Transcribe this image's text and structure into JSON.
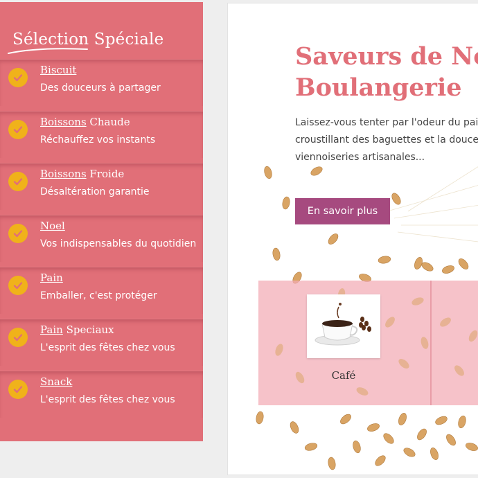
{
  "sidebar": {
    "title": "Sélection Spéciale",
    "items": [
      {
        "name_main": "Biscuit",
        "name_rest": "",
        "desc": "Des douceurs à partager"
      },
      {
        "name_main": "Boissons",
        "name_rest": "Chaude",
        "desc": "Réchauffez vos instants"
      },
      {
        "name_main": "Boissons",
        "name_rest": "Froide",
        "desc": "Désaltération garantie"
      },
      {
        "name_main": "Noel",
        "name_rest": "",
        "desc": "Vos indispensables du quotidien"
      },
      {
        "name_main": "Pain",
        "name_rest": "",
        "desc": "Emballer, c'est protéger"
      },
      {
        "name_main": "Pain",
        "name_rest": "Speciaux",
        "desc": "L'esprit des fêtes chez vous"
      },
      {
        "name_main": "Snack",
        "name_rest": "",
        "desc": "L'esprit des fêtes chez vous"
      }
    ]
  },
  "hero": {
    "title_line1": "Saveurs de No",
    "title_line2": "Boulangerie",
    "text_line1": "Laissez-vous tenter par l'odeur du pain",
    "text_line2": "croustillant des baguettes et la douce",
    "text_line3": "viennoiseries artisanales...",
    "button_label": "En savoir plus"
  },
  "category_card": {
    "label": "Café",
    "icon": "coffee-cup-icon"
  },
  "colors": {
    "sidebar_bg": "#e16f78",
    "accent_check": "#f0b21a",
    "title_pink": "#e16f78",
    "button_purple": "#a64a7f",
    "band_pink": "#f3abb4"
  }
}
